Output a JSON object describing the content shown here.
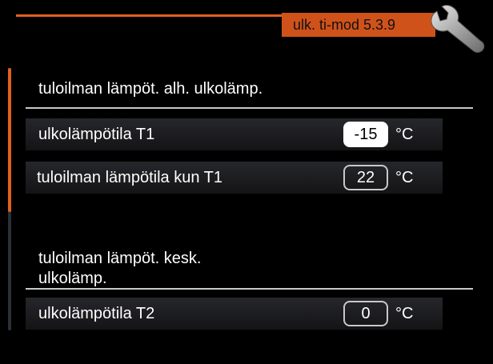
{
  "header": {
    "title": "ulk. ti-mod 5.3.9",
    "icon": "wrench-icon"
  },
  "sections": [
    {
      "title": "tuloilman lämpöt. alh. ulkolämp."
    },
    {
      "title_line1": "tuloilman lämpöt. kesk.",
      "title_line2": "ulkolämp."
    }
  ],
  "rows": [
    {
      "label": "ulkolämpötila T1",
      "value": "-15",
      "unit": "°C",
      "selected": true
    },
    {
      "label": "tuloilman lämpötila kun T1",
      "value": "22",
      "unit": "°C",
      "selected": false
    },
    {
      "label": "ulkolämpötila T2",
      "value": "0",
      "unit": "°C",
      "selected": false
    }
  ],
  "colors": {
    "accent": "#e0611f",
    "background": "#000000"
  }
}
